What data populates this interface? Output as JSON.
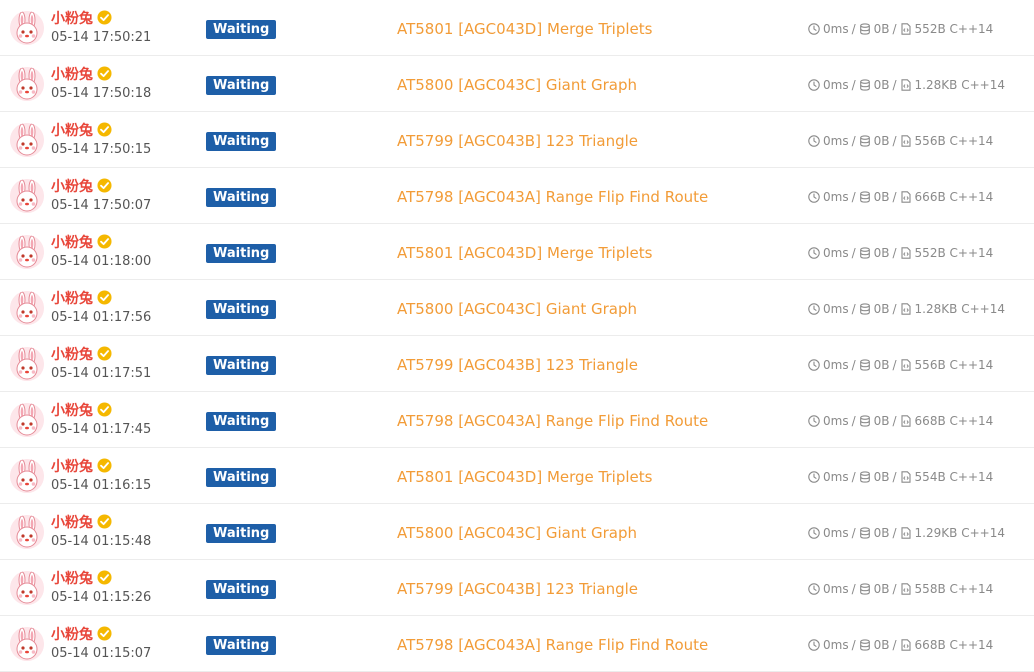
{
  "submissions": [
    {
      "user": "小粉兔",
      "time": "05-14 17:50:21",
      "status": "Waiting",
      "problem": "AT5801 [AGC043D] Merge Triplets",
      "time_used": "0ms",
      "memory": "0B",
      "code_size": "552B",
      "language": "C++14"
    },
    {
      "user": "小粉兔",
      "time": "05-14 17:50:18",
      "status": "Waiting",
      "problem": "AT5800 [AGC043C] Giant Graph",
      "time_used": "0ms",
      "memory": "0B",
      "code_size": "1.28KB",
      "language": "C++14"
    },
    {
      "user": "小粉兔",
      "time": "05-14 17:50:15",
      "status": "Waiting",
      "problem": "AT5799 [AGC043B] 123 Triangle",
      "time_used": "0ms",
      "memory": "0B",
      "code_size": "556B",
      "language": "C++14"
    },
    {
      "user": "小粉兔",
      "time": "05-14 17:50:07",
      "status": "Waiting",
      "problem": "AT5798 [AGC043A] Range Flip Find Route",
      "time_used": "0ms",
      "memory": "0B",
      "code_size": "666B",
      "language": "C++14"
    },
    {
      "user": "小粉兔",
      "time": "05-14 01:18:00",
      "status": "Waiting",
      "problem": "AT5801 [AGC043D] Merge Triplets",
      "time_used": "0ms",
      "memory": "0B",
      "code_size": "552B",
      "language": "C++14"
    },
    {
      "user": "小粉兔",
      "time": "05-14 01:17:56",
      "status": "Waiting",
      "problem": "AT5800 [AGC043C] Giant Graph",
      "time_used": "0ms",
      "memory": "0B",
      "code_size": "1.28KB",
      "language": "C++14"
    },
    {
      "user": "小粉兔",
      "time": "05-14 01:17:51",
      "status": "Waiting",
      "problem": "AT5799 [AGC043B] 123 Triangle",
      "time_used": "0ms",
      "memory": "0B",
      "code_size": "556B",
      "language": "C++14"
    },
    {
      "user": "小粉兔",
      "time": "05-14 01:17:45",
      "status": "Waiting",
      "problem": "AT5798 [AGC043A] Range Flip Find Route",
      "time_used": "0ms",
      "memory": "0B",
      "code_size": "668B",
      "language": "C++14"
    },
    {
      "user": "小粉兔",
      "time": "05-14 01:16:15",
      "status": "Waiting",
      "problem": "AT5801 [AGC043D] Merge Triplets",
      "time_used": "0ms",
      "memory": "0B",
      "code_size": "554B",
      "language": "C++14"
    },
    {
      "user": "小粉兔",
      "time": "05-14 01:15:48",
      "status": "Waiting",
      "problem": "AT5800 [AGC043C] Giant Graph",
      "time_used": "0ms",
      "memory": "0B",
      "code_size": "1.29KB",
      "language": "C++14"
    },
    {
      "user": "小粉兔",
      "time": "05-14 01:15:26",
      "status": "Waiting",
      "problem": "AT5799 [AGC043B] 123 Triangle",
      "time_used": "0ms",
      "memory": "0B",
      "code_size": "558B",
      "language": "C++14"
    },
    {
      "user": "小粉兔",
      "time": "05-14 01:15:07",
      "status": "Waiting",
      "problem": "AT5798 [AGC043A] Range Flip Find Route",
      "time_used": "0ms",
      "memory": "0B",
      "code_size": "668B",
      "language": "C++14"
    }
  ],
  "meta_separator": "/",
  "icons": {
    "time": "clock-icon",
    "memory": "database-icon",
    "code": "file-code-icon",
    "verified": "verified-badge-icon",
    "avatar": "bunny-avatar"
  },
  "colors": {
    "username": "#e8463a",
    "status_bg": "#1e5fa8",
    "problem_link": "#f29c38",
    "meta_text": "#8a8a8a",
    "verified": "#f5b800"
  }
}
